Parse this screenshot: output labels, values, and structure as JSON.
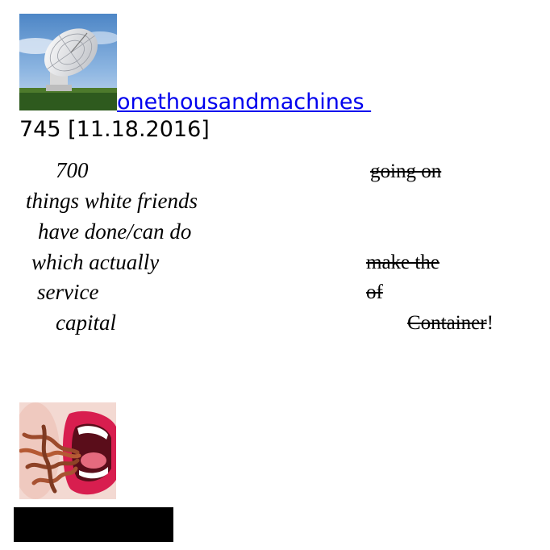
{
  "profile": {
    "username": "onethousandmachines ",
    "avatar_icon": "radio-telescope-photo"
  },
  "post": {
    "number_date": "745 [11.18.2016]"
  },
  "poem_left": [
    "700",
    "things white friends",
    "have done/can do",
    "which actually",
    "service",
    "capital"
  ],
  "poem_right": {
    "line1": "going on",
    "line2": "make the",
    "line3": "of",
    "line4_struck": "Container",
    "line4_tail": "!"
  },
  "footer": {
    "avatar_icon": "mouth-with-worms-photo"
  }
}
